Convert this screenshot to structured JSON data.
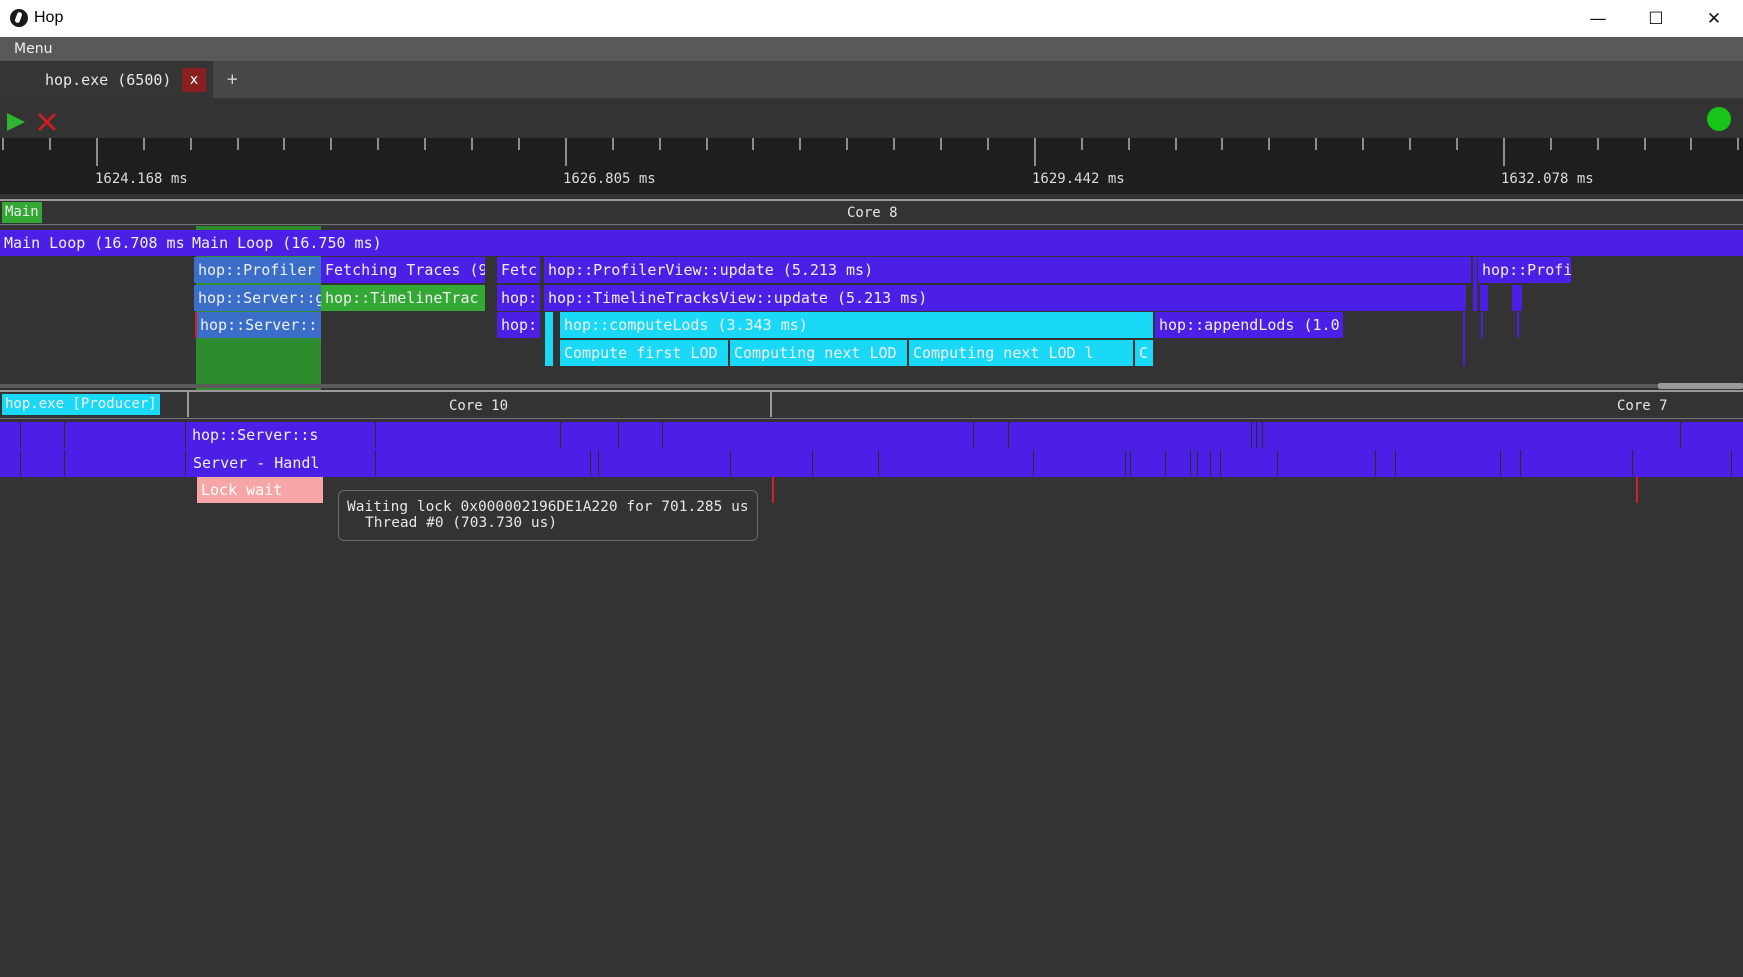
{
  "window": {
    "title": "Hop",
    "minimize_glyph": "—",
    "maximize_glyph": "☐",
    "close_glyph": "✕"
  },
  "menubar": {
    "menu_label": "Menu"
  },
  "tabs": [
    {
      "label": "hop.exe (6500)",
      "close_label": "x"
    }
  ],
  "add_tab_label": "+",
  "toolbar": {
    "play_icon": "play-icon",
    "stop_icon": "stop-icon",
    "status_color": "#19c419"
  },
  "ruler": {
    "labels": [
      "1624.168 ms",
      "1626.805 ms",
      "1629.442 ms",
      "1632.078 ms"
    ]
  },
  "track_main": {
    "name": "Main",
    "core_label": "Core 8",
    "blocks": {
      "main_loop_1": "Main Loop (16.708 ms",
      "main_loop_2": "Main Loop (16.750 ms)",
      "profiler": "hop::Profiler",
      "fetching_traces": "Fetching Traces (9",
      "fetc": "Fetc",
      "profiler_view_update": "hop::ProfilerView::update (5.213 ms)",
      "hop_profi": "hop::Profi",
      "server_1": "hop::Server::g",
      "timeline_trac": "hop::TimelineTrac",
      "hop_short_1": "hop:",
      "timeline_tracks_view_update": "hop::TimelineTracksView::update (5.213 ms)",
      "server_2": "hop::Server::",
      "hop_short_2": "hop:",
      "compute_lods": "hop::computeLods (3.343 ms)",
      "append_lods": "hop::appendLods (1.0",
      "compute_first_lod": "Compute first LOD leve",
      "computing_next_lod_1": "Computing next LOD l",
      "computing_next_lod_2": "Computing next LOD l",
      "c_short": "C"
    }
  },
  "track_producer": {
    "name": "hop.exe [Producer]",
    "core_label_1": "Core 10",
    "core_label_2": "Core 7",
    "blocks": {
      "server_s": "hop::Server::s",
      "server_handl": "Server - Handl",
      "lock_wait": "Lock wait"
    }
  },
  "tooltip": {
    "line1": "Waiting lock 0x000002196DE1A220 for 701.285 us",
    "line2": "Thread #0 (703.730 us)"
  }
}
